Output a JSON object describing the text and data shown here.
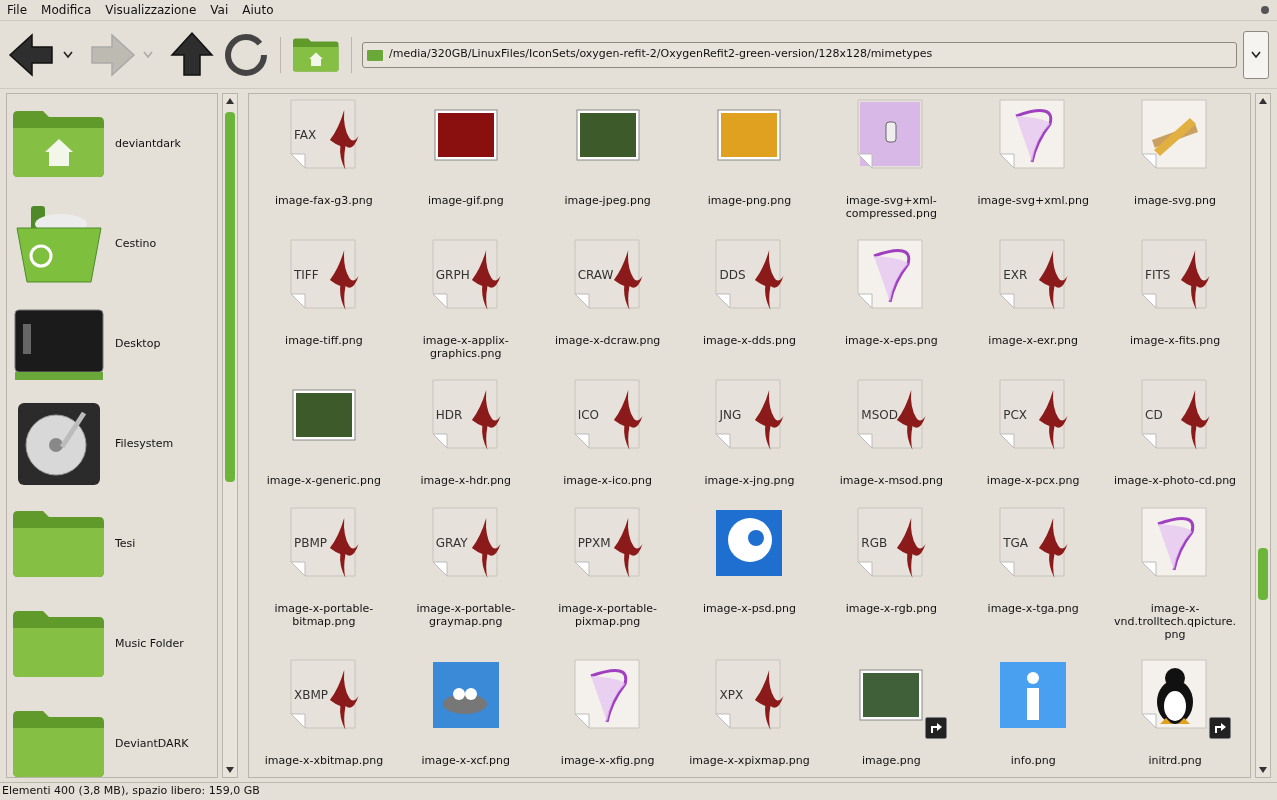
{
  "menu": [
    "File",
    "Modifica",
    "Visualizzazione",
    "Vai",
    "Aiuto"
  ],
  "toolbar": {
    "back_enabled": true,
    "forward_enabled": false
  },
  "location": "/media/320GB/LinuxFiles/IconSets/oxygen-refit-2/OxygenRefit2-green-version/128x128/mimetypes",
  "places": [
    {
      "kind": "home",
      "label": "deviantdark"
    },
    {
      "kind": "trash",
      "label": "Cestino"
    },
    {
      "kind": "desktop",
      "label": "Desktop"
    },
    {
      "kind": "drive",
      "label": "Filesystem"
    },
    {
      "kind": "folder",
      "label": "Tesi"
    },
    {
      "kind": "folder",
      "label": "Music Folder"
    },
    {
      "kind": "folder",
      "label": "DeviantDARK"
    }
  ],
  "files": [
    {
      "kind": "doc",
      "tag": "FAX",
      "name": "image-fax-g3.png",
      "link": false
    },
    {
      "kind": "photo",
      "name": "image-gif.png",
      "link": false
    },
    {
      "kind": "photo",
      "name": "image-jpeg.png",
      "link": false
    },
    {
      "kind": "photo",
      "name": "image-png.png",
      "link": false
    },
    {
      "kind": "zip",
      "name": "image-svg+xml-compressed.png",
      "link": false
    },
    {
      "kind": "vector",
      "name": "image-svg+xml.png",
      "link": false
    },
    {
      "kind": "pencil",
      "name": "image-svg.png",
      "link": false
    },
    {
      "kind": "doc",
      "tag": "TIFF",
      "name": "image-tiff.png",
      "link": false
    },
    {
      "kind": "doc",
      "tag": "GRPH",
      "name": "image-x-applix-graphics.png",
      "link": false
    },
    {
      "kind": "doc",
      "tag": "CRAW",
      "name": "image-x-dcraw.png",
      "link": false
    },
    {
      "kind": "doc",
      "tag": "DDS",
      "name": "image-x-dds.png",
      "link": false
    },
    {
      "kind": "vector",
      "name": "image-x-eps.png",
      "link": false
    },
    {
      "kind": "doc",
      "tag": "EXR",
      "name": "image-x-exr.png",
      "link": false
    },
    {
      "kind": "doc",
      "tag": "FITS",
      "name": "image-x-fits.png",
      "link": false
    },
    {
      "kind": "photo",
      "name": "image-x-generic.png",
      "link": false
    },
    {
      "kind": "doc",
      "tag": "HDR",
      "name": "image-x-hdr.png",
      "link": false
    },
    {
      "kind": "doc",
      "tag": "ICO",
      "name": "image-x-ico.png",
      "link": false
    },
    {
      "kind": "doc",
      "tag": "JNG",
      "name": "image-x-jng.png",
      "link": false
    },
    {
      "kind": "doc",
      "tag": "MSOD",
      "name": "image-x-msod.png",
      "link": false
    },
    {
      "kind": "doc",
      "tag": "PCX",
      "name": "image-x-pcx.png",
      "link": false
    },
    {
      "kind": "doc",
      "tag": "CD",
      "name": "image-x-photo-cd.png",
      "link": false
    },
    {
      "kind": "doc",
      "tag": "PBMP",
      "name": "image-x-portable-bitmap.png",
      "link": false
    },
    {
      "kind": "doc",
      "tag": "GRAY",
      "name": "image-x-portable-graymap.png",
      "link": false
    },
    {
      "kind": "doc",
      "tag": "PPXM",
      "name": "image-x-portable-pixmap.png",
      "link": false
    },
    {
      "kind": "psd",
      "name": "image-x-psd.png",
      "link": false
    },
    {
      "kind": "doc",
      "tag": "RGB",
      "name": "image-x-rgb.png",
      "link": false
    },
    {
      "kind": "doc",
      "tag": "TGA",
      "name": "image-x-tga.png",
      "link": false
    },
    {
      "kind": "vector",
      "name": "image-x-vnd.trolltech.qpicture.png",
      "link": false
    },
    {
      "kind": "doc",
      "tag": "XBMP",
      "name": "image-x-xbitmap.png",
      "link": false
    },
    {
      "kind": "xcf",
      "name": "image-x-xcf.png",
      "link": false
    },
    {
      "kind": "vector",
      "name": "image-x-xfig.png",
      "link": false
    },
    {
      "kind": "doc",
      "tag": "XPX",
      "name": "image-x-xpixmap.png",
      "link": false
    },
    {
      "kind": "photo",
      "name": "image.png",
      "link": true
    },
    {
      "kind": "info",
      "name": "info.png",
      "link": false
    },
    {
      "kind": "penguin",
      "name": "initrd.png",
      "link": true
    }
  ],
  "status_bar": "Elementi 400 (3,8 MB), spazio libero: 159,0 GB"
}
